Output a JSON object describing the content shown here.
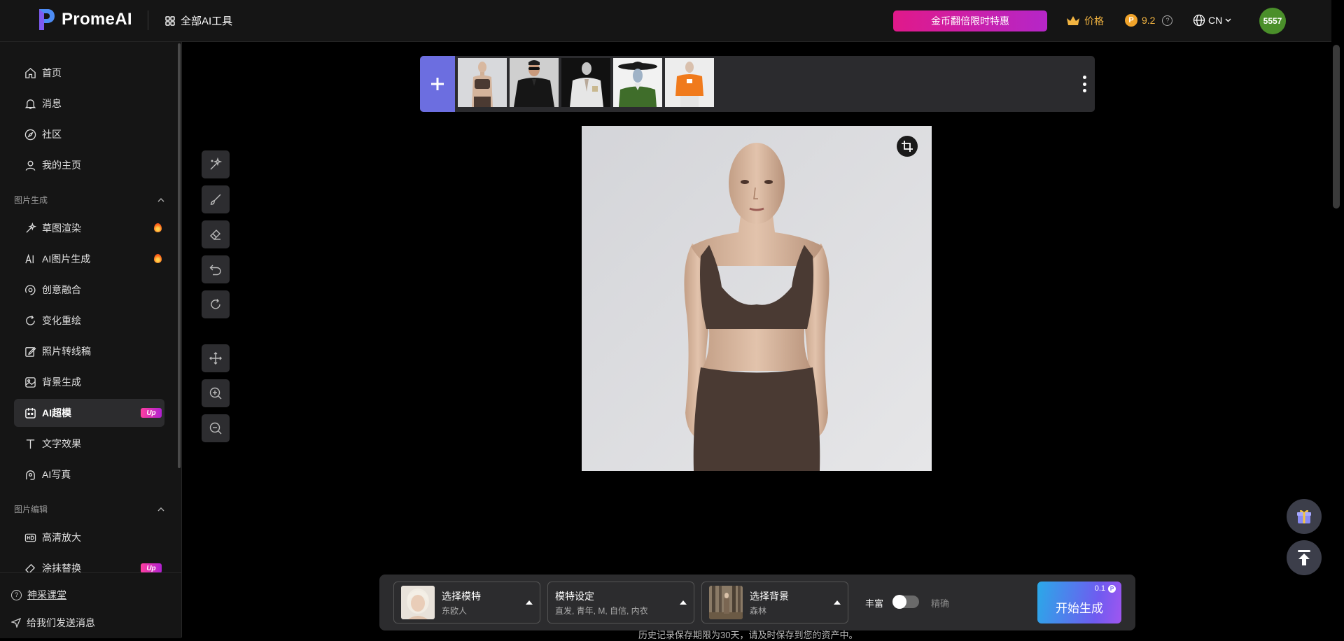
{
  "header": {
    "logo_text": "PromeAI",
    "all_tools": "全部AI工具",
    "promo": "金币翻倍限时特惠",
    "price": "价格",
    "credits": "9.2",
    "lang": "CN",
    "avatar": "5557"
  },
  "sidebar": {
    "items": [
      {
        "label": "首页",
        "icon": "home-icon"
      },
      {
        "label": "消息",
        "icon": "bell-icon"
      },
      {
        "label": "社区",
        "icon": "compass-icon"
      },
      {
        "label": "我的主页",
        "icon": "user-icon"
      }
    ],
    "sections": [
      {
        "title": "图片生成",
        "items": [
          {
            "label": "草图渲染",
            "icon": "sparkle-brush-icon",
            "badge": "fire"
          },
          {
            "label": "AI图片生成",
            "icon": "ai-image-icon",
            "badge": "fire"
          },
          {
            "label": "创意融合",
            "icon": "blend-icon"
          },
          {
            "label": "变化重绘",
            "icon": "refresh-icon"
          },
          {
            "label": "照片转线稿",
            "icon": "edit-icon"
          },
          {
            "label": "背景生成",
            "icon": "image-icon"
          },
          {
            "label": "AI超模",
            "icon": "model-icon",
            "badge": "Up",
            "active": true
          },
          {
            "label": "文字效果",
            "icon": "text-icon"
          },
          {
            "label": "AI写真",
            "icon": "portrait-icon"
          }
        ]
      },
      {
        "title": "图片编辑",
        "items": [
          {
            "label": "高清放大",
            "icon": "hd-icon"
          },
          {
            "label": "涂抹替换",
            "icon": "eraser-icon",
            "badge": "Up"
          }
        ]
      }
    ],
    "bottom": {
      "tutorial": "神采课堂",
      "feedback": "给我们发送消息"
    }
  },
  "tools": [
    "magic-wand-icon",
    "brush-icon",
    "eraser-icon",
    "undo-icon",
    "redo-icon",
    "move-icon",
    "zoom-in-icon",
    "zoom-out-icon"
  ],
  "thumbnails": [
    "mannequin-brown-top",
    "man-black-shirt-sunglasses",
    "mannequin-white-jacket",
    "mannequin-cowboy-hat",
    "mannequin-orange-hoodie"
  ],
  "panel": {
    "model": {
      "title": "选择模特",
      "sub": "东欧人"
    },
    "settings": {
      "title": "模特设定",
      "sub": "直发, 青年, M, 自信, 内衣"
    },
    "background": {
      "title": "选择背景",
      "sub": "森林"
    },
    "toggle_left": "丰富",
    "toggle_right": "精确",
    "generate": {
      "label": "开始生成",
      "cost": "0.1"
    }
  },
  "history_note": "历史记录保存期限为30天，请及时保存到您的资产中。",
  "colors": {
    "accent": "#6c6ee0",
    "promo_start": "#e0198a",
    "promo_end": "#b526c8",
    "gold": "#f2b441",
    "avatar_bg": "#4a8f2a"
  }
}
